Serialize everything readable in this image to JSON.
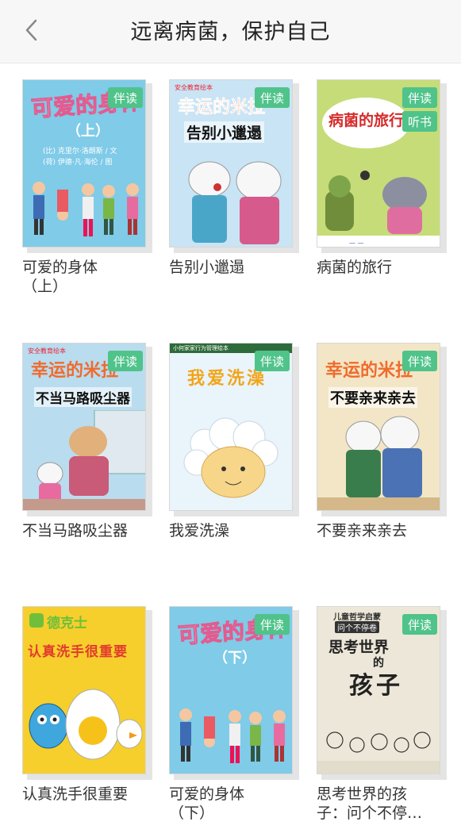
{
  "header": {
    "title": "远离病菌，保护自己"
  },
  "books": [
    {
      "title": "可爱的身体（上）",
      "title_lines": [
        "可爱的身体",
        "（上）"
      ],
      "badges": [
        "伴读"
      ],
      "cover_title": "可爱的身体",
      "cover_sub": "（上）",
      "cover_authors": "(比) 克里尔·洛朗斯 / 文",
      "cover_illus": "(荷) 伊德·凡·海伦 / 图",
      "cover_bg": "#7fcbe8"
    },
    {
      "title": "告别小邋遢",
      "title_lines": [
        "告别小邋遢"
      ],
      "badges": [
        "伴读"
      ],
      "cover_series": "幸运的米拉",
      "cover_title": "告别小邋遢",
      "cover_top": "安全教育绘本",
      "cover_bg": "#c9e4f4"
    },
    {
      "title": "病菌的旅行",
      "title_lines": [
        "病菌的旅行"
      ],
      "badges": [
        "伴读",
        "听书"
      ],
      "cover_title": "病菌的旅行",
      "cover_bg": "#c6dc78"
    },
    {
      "title": "不当马路吸尘器",
      "title_lines": [
        "不当马路吸尘器"
      ],
      "badges": [
        "伴读"
      ],
      "cover_series": "幸运的米拉",
      "cover_title": "不当马路吸尘器",
      "cover_top": "安全教育绘本",
      "cover_bg": "#b9dcef"
    },
    {
      "title": "我爱洗澡",
      "title_lines": [
        "我爱洗澡"
      ],
      "badges": [
        "伴读"
      ],
      "cover_top": "小何家家行为管理绘本",
      "cover_title": "我爱洗澡",
      "cover_bg": "#e9f4fb"
    },
    {
      "title": "不要亲来亲去",
      "title_lines": [
        "不要亲来亲去"
      ],
      "badges": [
        "伴读"
      ],
      "cover_series": "幸运的米拉",
      "cover_title": "不要亲来亲去",
      "cover_bg": "#f2e6c6"
    },
    {
      "title": "认真洗手很重要",
      "title_lines": [
        "认真洗手很重要"
      ],
      "badges": [],
      "cover_brand": "德克士",
      "cover_title": "认真洗手很重要",
      "cover_bg": "#f6cf2c"
    },
    {
      "title": "可爱的身体（下）",
      "title_lines": [
        "可爱的身体",
        "（下）"
      ],
      "badges": [
        "伴读"
      ],
      "cover_title": "可爱的身体",
      "cover_sub": "（下）",
      "cover_bg": "#7fcbe8"
    },
    {
      "title": "思考世界的孩子：问个不停…",
      "title_lines": [
        "思考世界的孩",
        "子：问个不停…"
      ],
      "badges": [
        "伴读"
      ],
      "cover_top": "儿童哲学启蒙",
      "cover_q": "问个不停卷",
      "cover_title": "思考世界的孩子",
      "cover_title_a": "思考世界",
      "cover_title_b": "的",
      "cover_title_c": "孩子",
      "cover_bg": "#ece7d8"
    }
  ],
  "colors": {
    "badge": "#4fc38a",
    "header_bg": "#f7f7f7"
  },
  "icons": {
    "back": "chevron-left-icon"
  }
}
